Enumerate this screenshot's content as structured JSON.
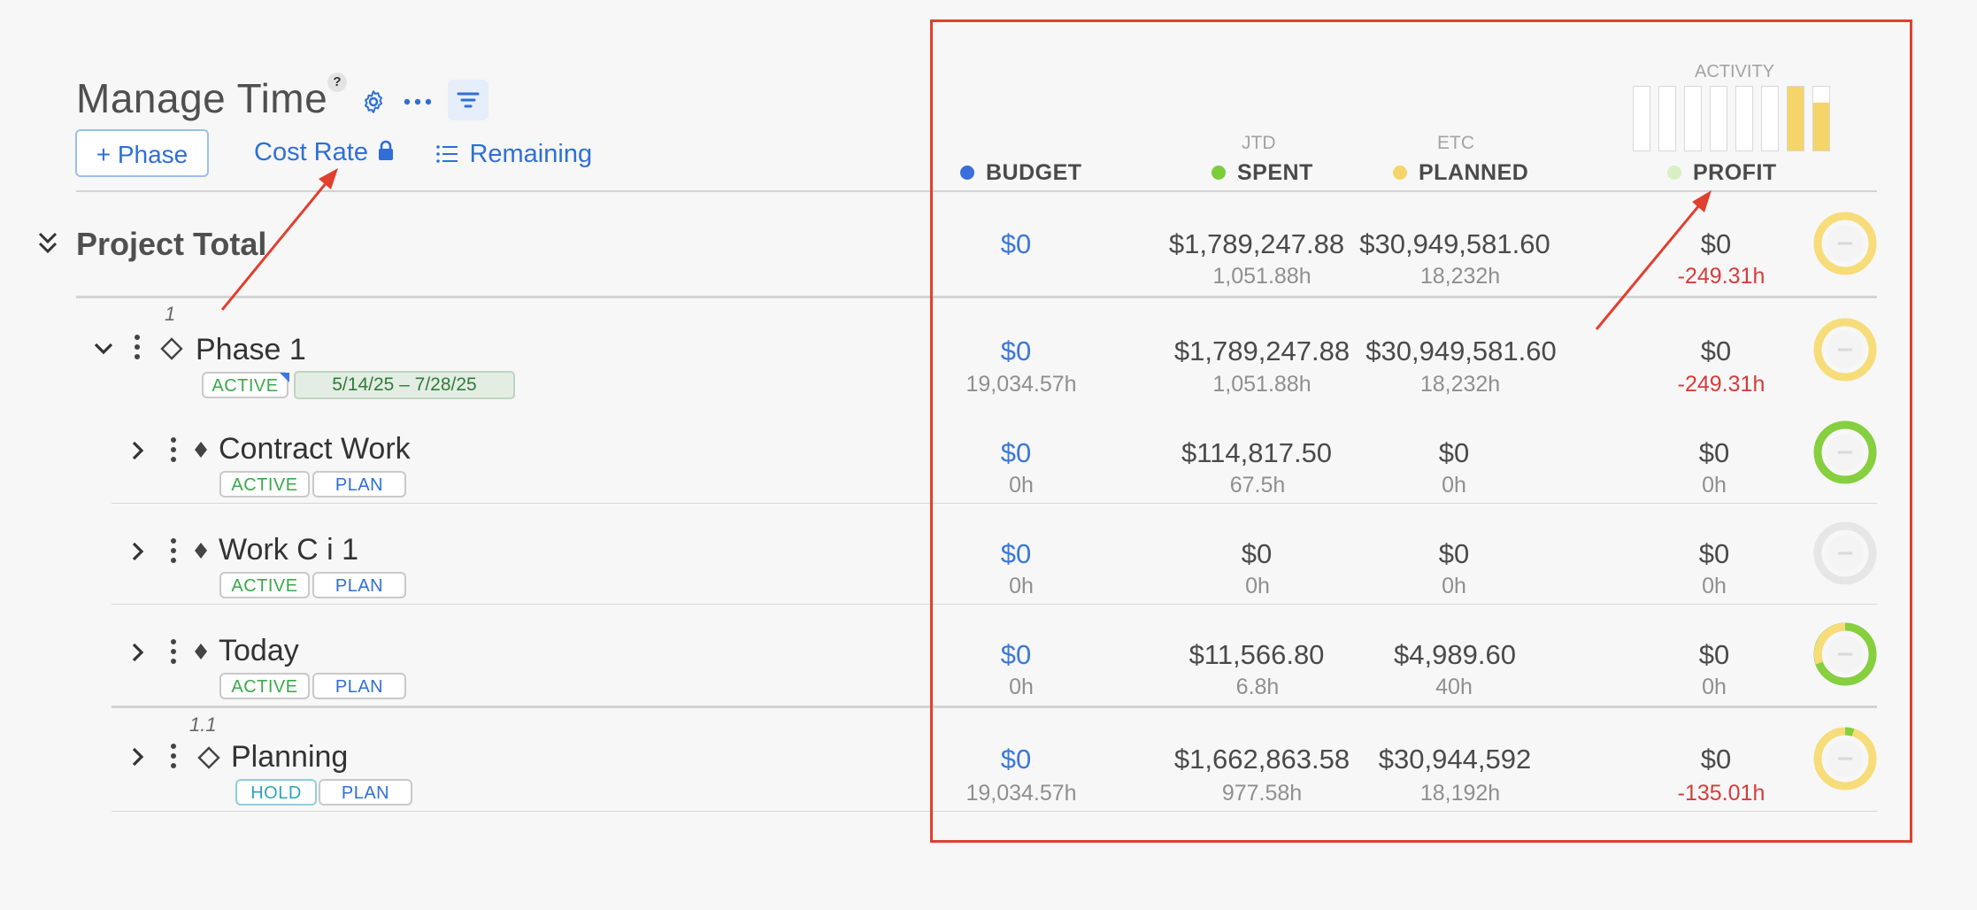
{
  "header": {
    "title": "Manage Time",
    "help": "?",
    "add_phase": "+ Phase",
    "cost_rate": "Cost Rate",
    "remaining": "Remaining"
  },
  "columns": {
    "activity": "ACTIVITY",
    "budget": "BUDGET",
    "spent_sub": "JTD",
    "spent": "SPENT",
    "planned_sub": "ETC",
    "planned": "PLANNED",
    "profit": "PROFIT"
  },
  "colors": {
    "budget": "#3b6fd9",
    "spent": "#7ccc3b",
    "planned": "#f5d46a",
    "profit": "#d8efc4",
    "annotation": "#e0402f"
  },
  "activity_bars": [
    0,
    0,
    0,
    0,
    0,
    0,
    1.0,
    0.75
  ],
  "project_total": {
    "label": "Project Total",
    "budget": "$0",
    "spent": "$1,789,247.88",
    "spent_hours": "1,051.88h",
    "planned": "$30,949,581.60",
    "planned_hours": "18,232h",
    "profit": "$0",
    "profit_hours": "-249.31h"
  },
  "phase": {
    "number": "1",
    "name": "Phase 1",
    "status": "ACTIVE",
    "date_range": "5/14/25  –  7/28/25",
    "budget": "$0",
    "budget_hours": "19,034.57h",
    "spent": "$1,789,247.88",
    "spent_hours": "1,051.88h",
    "planned": "$30,949,581.60",
    "planned_hours": "18,232h",
    "profit": "$0",
    "profit_hours": "-249.31h"
  },
  "work_rows": [
    {
      "name": "Contract Work",
      "status": "ACTIVE",
      "tag": "PLAN",
      "budget": "$0",
      "budget_hours": "0h",
      "spent": "$114,817.50",
      "spent_hours": "67.5h",
      "planned": "$0",
      "planned_hours": "0h",
      "profit": "$0",
      "profit_hours": "0h"
    },
    {
      "name": "Work C i 1",
      "status": "ACTIVE",
      "tag": "PLAN",
      "budget": "$0",
      "budget_hours": "0h",
      "spent": "$0",
      "spent_hours": "0h",
      "planned": "$0",
      "planned_hours": "0h",
      "profit": "$0",
      "profit_hours": "0h"
    },
    {
      "name": "Today",
      "status": "ACTIVE",
      "tag": "PLAN",
      "budget": "$0",
      "budget_hours": "0h",
      "spent": "$11,566.80",
      "spent_hours": "6.8h",
      "planned": "$4,989.60",
      "planned_hours": "40h",
      "profit": "$0",
      "profit_hours": "0h"
    }
  ],
  "subphase": {
    "number": "1.1",
    "name": "Planning",
    "status": "HOLD",
    "tag": "PLAN",
    "budget": "$0",
    "budget_hours": "19,034.57h",
    "spent": "$1,662,863.58",
    "spent_hours": "977.58h",
    "planned": "$30,944,592",
    "planned_hours": "18,192h",
    "profit": "$0",
    "profit_hours": "-135.01h"
  },
  "icons": {
    "settings": "gear-icon",
    "more": "ellipsis-icon",
    "filter": "filter-icon",
    "lock": "lock-icon",
    "list": "list-icon",
    "collapse_all": "double-chevron-down-icon",
    "expand": "chevron-right-icon",
    "collapse": "chevron-down-icon",
    "menu": "kebab-icon",
    "phase": "diamond-outline-icon",
    "work": "diamond-icon",
    "progress": "donut-icon"
  }
}
